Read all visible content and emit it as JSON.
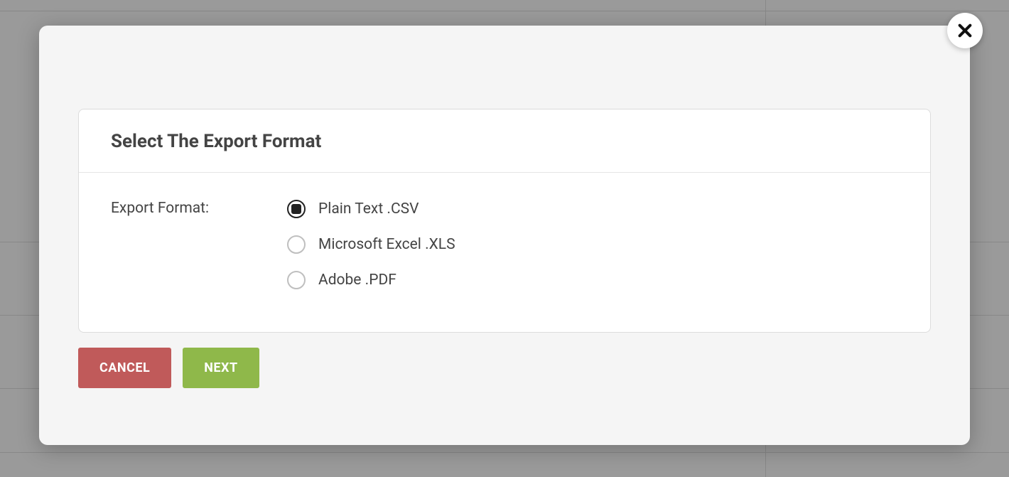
{
  "dialog": {
    "title": "Select The Export Format",
    "field_label": "Export Format:",
    "options": [
      {
        "label": "Plain Text .CSV",
        "selected": true
      },
      {
        "label": "Microsoft Excel .XLS",
        "selected": false
      },
      {
        "label": "Adobe .PDF",
        "selected": false
      }
    ],
    "buttons": {
      "cancel": "CANCEL",
      "next": "NEXT"
    }
  }
}
